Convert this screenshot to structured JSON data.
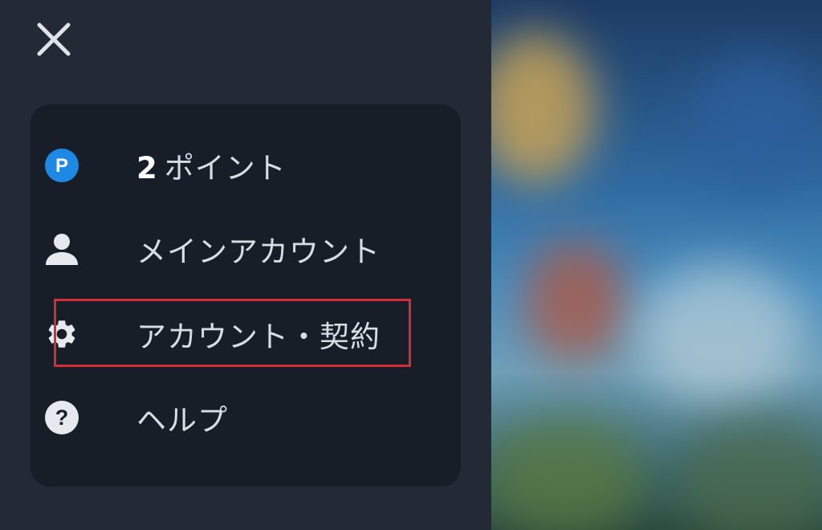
{
  "drawer": {
    "close_icon": "close-icon",
    "menu": {
      "items": [
        {
          "icon": "points-icon",
          "icon_letter": "P",
          "value": "2",
          "label": "ポイント"
        },
        {
          "icon": "user-icon",
          "label": "メインアカウント"
        },
        {
          "icon": "gear-icon",
          "label": "アカウント・契約"
        },
        {
          "icon": "help-icon",
          "icon_glyph": "?",
          "label": "ヘルプ"
        }
      ]
    }
  },
  "colors": {
    "drawer_background": "#232a35",
    "menu_card_background": "#181e27",
    "text": "#d7dde5",
    "points_badge": "#1e88e5",
    "highlight": "#d42d36"
  }
}
